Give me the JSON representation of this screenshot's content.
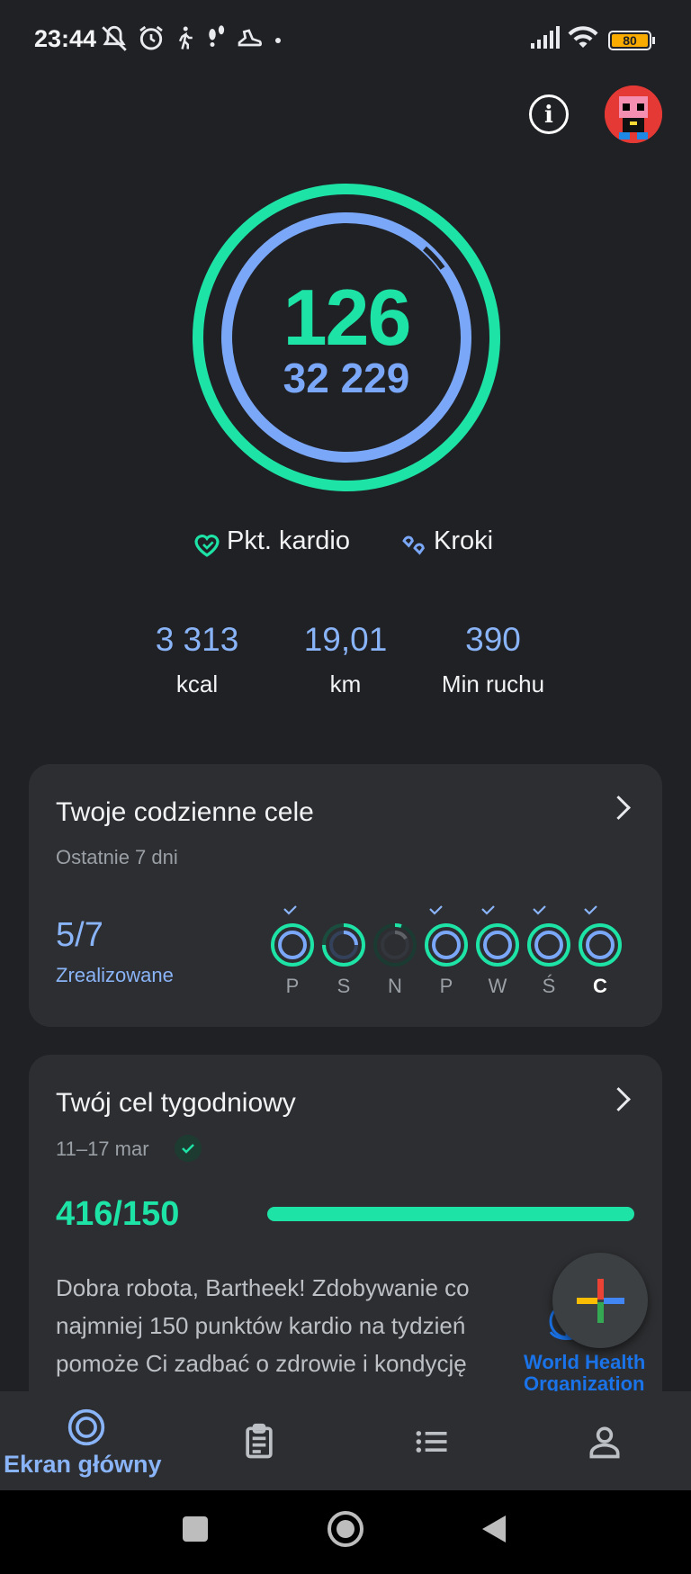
{
  "status_bar": {
    "time": "23:44",
    "battery": "80",
    "icons": [
      "mute-icon",
      "alarm-icon",
      "walking-icon",
      "footsteps-icon",
      "shoe-icon",
      "dot-icon",
      "signal-icon",
      "wifi-icon",
      "battery-icon"
    ]
  },
  "header": {
    "info_icon": "info-icon",
    "avatar": "profile-avatar"
  },
  "rings": {
    "cardio_points": "126",
    "steps": "32 229",
    "cardio_color": "#1ee3a6",
    "steps_color": "#7aa7f7"
  },
  "legend": {
    "cardio_label": "Pkt. kardio",
    "steps_label": "Kroki"
  },
  "stats": [
    {
      "value": "3 313",
      "label": "kcal"
    },
    {
      "value": "19,01",
      "label": "km"
    },
    {
      "value": "390",
      "label": "Min ruchu"
    }
  ],
  "daily_goals": {
    "title": "Twoje codzienne cele",
    "subtitle": "Ostatnie 7 dni",
    "count": "5/7",
    "status": "Zrealizowane",
    "days": [
      {
        "label": "P",
        "achieved": true
      },
      {
        "label": "S",
        "achieved": false
      },
      {
        "label": "N",
        "achieved": false
      },
      {
        "label": "P",
        "achieved": true
      },
      {
        "label": "W",
        "achieved": true
      },
      {
        "label": "Ś",
        "achieved": true
      },
      {
        "label": "C",
        "achieved": true
      }
    ]
  },
  "weekly_goal": {
    "title": "Twój cel tygodniowy",
    "dates": "11–17 mar",
    "progress": "416/150",
    "progress_fraction": 1.0,
    "body": "Dobra robota, Bartheek! Zdobywanie co najmniej 150 punktów kardio na tydzień pomoże Ci zadbać o zdrowie i kondycję",
    "who_line1": "World Health",
    "who_line2": "Organization"
  },
  "nav": {
    "home_label": "Ekran główny",
    "items": [
      "home-icon",
      "journal-icon",
      "browse-icon",
      "profile-icon"
    ]
  }
}
